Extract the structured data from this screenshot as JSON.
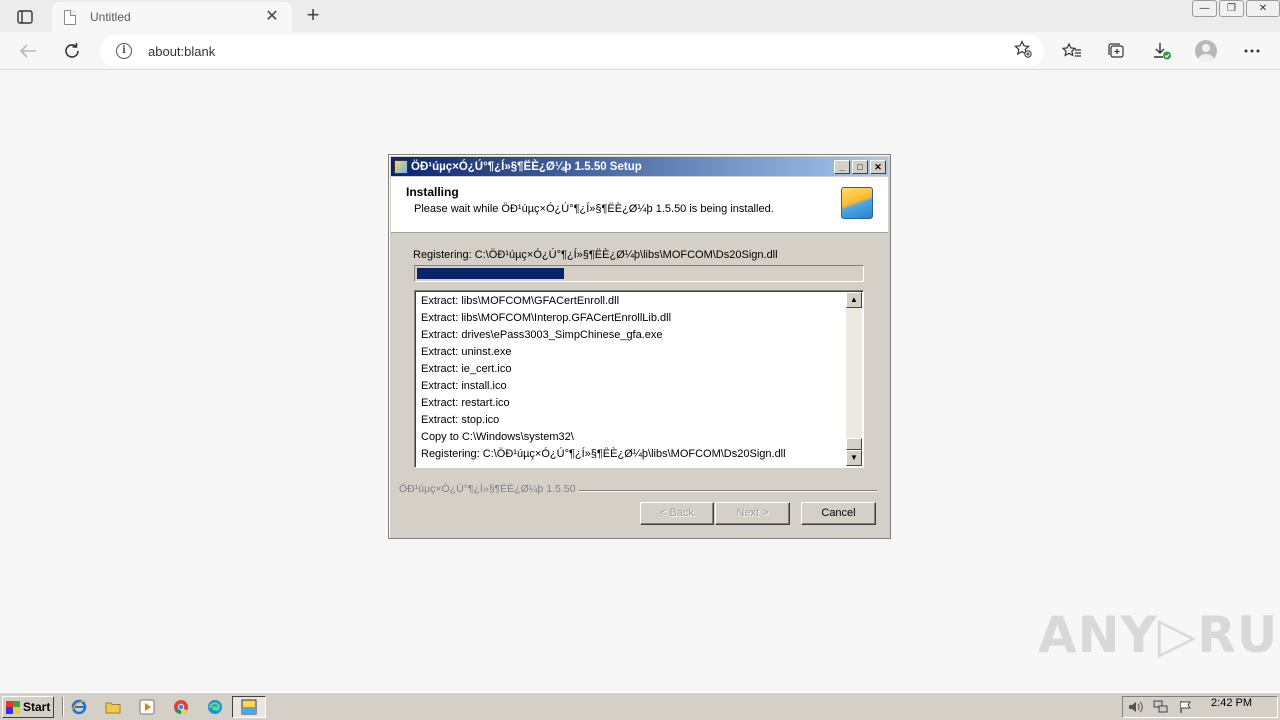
{
  "browser": {
    "tab_title": "Untitled",
    "tab_close": "✕",
    "new_tab": "+",
    "url": "about:blank",
    "window_controls": {
      "minimize": "—",
      "restore": "❐",
      "close": "✕"
    }
  },
  "dialog": {
    "title": "ÖÐ¹úµç×Ó¿Ú°¶¿Í»§¶ËÈ¿Ø¼þ 1.5.50 Setup",
    "header_title": "Installing",
    "header_subtitle": "Please wait while ÖÐ¹úµç×Ó¿Ú°¶¿Í»§¶ËÈ¿Ø¼þ 1.5.50 is being installed.",
    "status": "Registering: C:\\ÖÐ¹úµç×Ó¿Ú°¶¿Í»§¶ËÈ¿Ø¼þ\\libs\\MOFCOM\\Ds20Sign.dll",
    "progress": 0.33,
    "log": [
      "Extract: libs\\MOFCOM\\GFACertEnroll.dll",
      "Extract: libs\\MOFCOM\\Interop.GFACertEnrollLib.dll",
      "Extract: drives\\ePass3003_SimpChinese_gfa.exe",
      "Extract: uninst.exe",
      "Extract: ie_cert.ico",
      "Extract: install.ico",
      "Extract: restart.ico",
      "Extract: stop.ico",
      "Copy to C:\\Windows\\system32\\",
      "Registering: C:\\ÖÐ¹úµç×Ó¿Ú°¶¿Í»§¶ËÈ¿Ø¼þ\\libs\\MOFCOM\\Ds20Sign.dll"
    ],
    "branding": "ÖÐ¹úµç×Ó¿Ú°¶¿Í»§¶ËÈ¿Ø¼þ 1.5.50",
    "buttons": {
      "back": "< Back",
      "next": "Next >",
      "cancel": "Cancel"
    },
    "scroll_up": "▲",
    "scroll_down": "▼"
  },
  "watermark": "ANY▷RUN",
  "taskbar": {
    "start": "Start",
    "clock": "2:42 PM"
  },
  "colors": {
    "title_gradient_start": "#0a246a",
    "title_gradient_end": "#a6caf0",
    "progress_fill": "#0a246a",
    "classic_gray": "#d4d0c8"
  }
}
